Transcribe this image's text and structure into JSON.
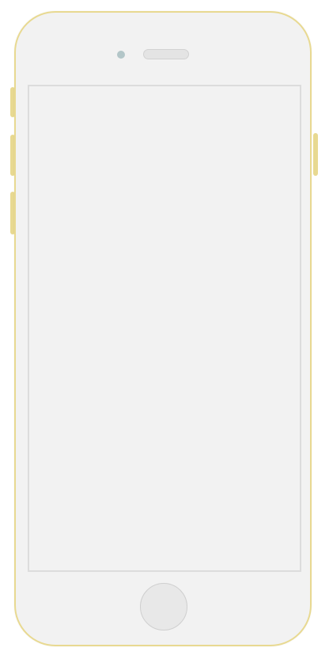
{
  "device": {
    "type": "smartphone",
    "frame_color": "#e8d991",
    "body_color": "#f2f2f2",
    "screen_content": ""
  },
  "icons": {
    "camera": "front-camera-icon",
    "speaker": "earpiece-speaker-icon",
    "home": "home-button-icon"
  }
}
